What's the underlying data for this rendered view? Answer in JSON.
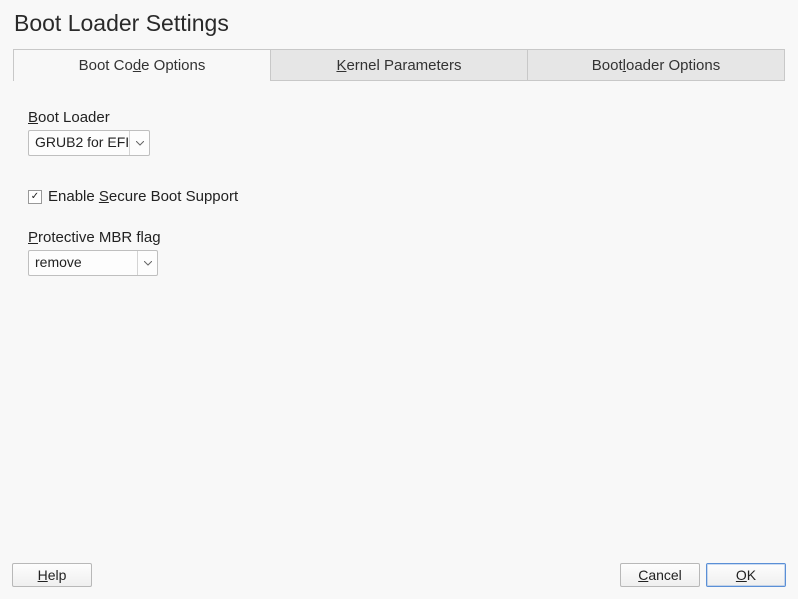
{
  "title": "Boot Loader Settings",
  "tabs": {
    "bootCode": {
      "prefix": "Boot Co",
      "accel": "d",
      "suffix": "e Options"
    },
    "kernel": {
      "prefix": "",
      "accel": "K",
      "suffix": "ernel Parameters"
    },
    "loader": {
      "prefix": "Boot",
      "accel": "l",
      "suffix": "oader Options"
    }
  },
  "bootLoader": {
    "labelPrefix": "",
    "labelAccel": "B",
    "labelSuffix": "oot Loader",
    "value": "GRUB2 for EFI"
  },
  "secureBoot": {
    "checked": true,
    "checkmark": "✓",
    "labelPrefix": "Enable ",
    "labelAccel": "S",
    "labelSuffix": "ecure Boot Support"
  },
  "mbr": {
    "labelPrefix": "",
    "labelAccel": "P",
    "labelSuffix": "rotective MBR flag",
    "value": "remove"
  },
  "buttons": {
    "help": {
      "prefix": "",
      "accel": "H",
      "suffix": "elp"
    },
    "cancel": {
      "prefix": "",
      "accel": "C",
      "suffix": "ancel"
    },
    "ok": {
      "prefix": "",
      "accel": "O",
      "suffix": "K"
    }
  }
}
